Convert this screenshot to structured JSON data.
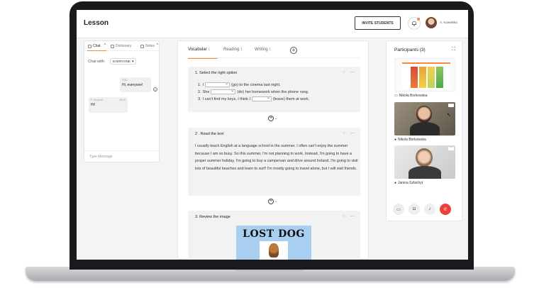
{
  "header": {
    "title": "Lesson",
    "invite_label": "INVITE STUDENTS",
    "user_name": "A. Kowalska"
  },
  "chat": {
    "tabs": [
      "Chat",
      "Dictionary",
      "Notes"
    ],
    "chat_with_label": "Chat with",
    "audience": "EVERYONE",
    "messages": [
      {
        "author": "YOU",
        "time": "",
        "text": "Hi, everyone!"
      },
      {
        "author": "F. Chojecki",
        "time": "15:32",
        "text": "Hi!"
      }
    ],
    "input_placeholder": "Type Message"
  },
  "lesson": {
    "tabs": [
      {
        "label": "Vocabular",
        "count": "1"
      },
      {
        "label": "Reading",
        "count": "1"
      },
      {
        "label": "Writing",
        "count": "1"
      }
    ],
    "exercise1": {
      "title": "1. Select the right option",
      "lines": [
        {
          "num": "1.",
          "before": "I",
          "after": "(go) to the cinema last night."
        },
        {
          "num": "2.",
          "before": "She",
          "after": "(do) her homework when the phone rang."
        },
        {
          "num": "3.",
          "before": "I can't find my keys, I think I",
          "after": "(leave) them at work."
        }
      ]
    },
    "exercise2": {
      "title": "2 . Read the text",
      "text": "I usually teach English at a language school in the summer. I often can't enjoy the summer because I am so busy. So this summer, I'm not planning to work. Instead, I'm going to have a proper summer holiday. I'm going to buy a campervan and drive around Ireland. I'm going to visit lots of beautiful beaches and learn to surf! I'm mostly going to travel alone, but I will visit friends."
    },
    "exercise3": {
      "title": "3. Review the image",
      "poster_text": "LOST DOG"
    }
  },
  "participants": {
    "title": "Participants (3)",
    "people": [
      "Nikola Borkowska",
      "Nikola Borkowska",
      "Janina Szlachyt"
    ]
  }
}
